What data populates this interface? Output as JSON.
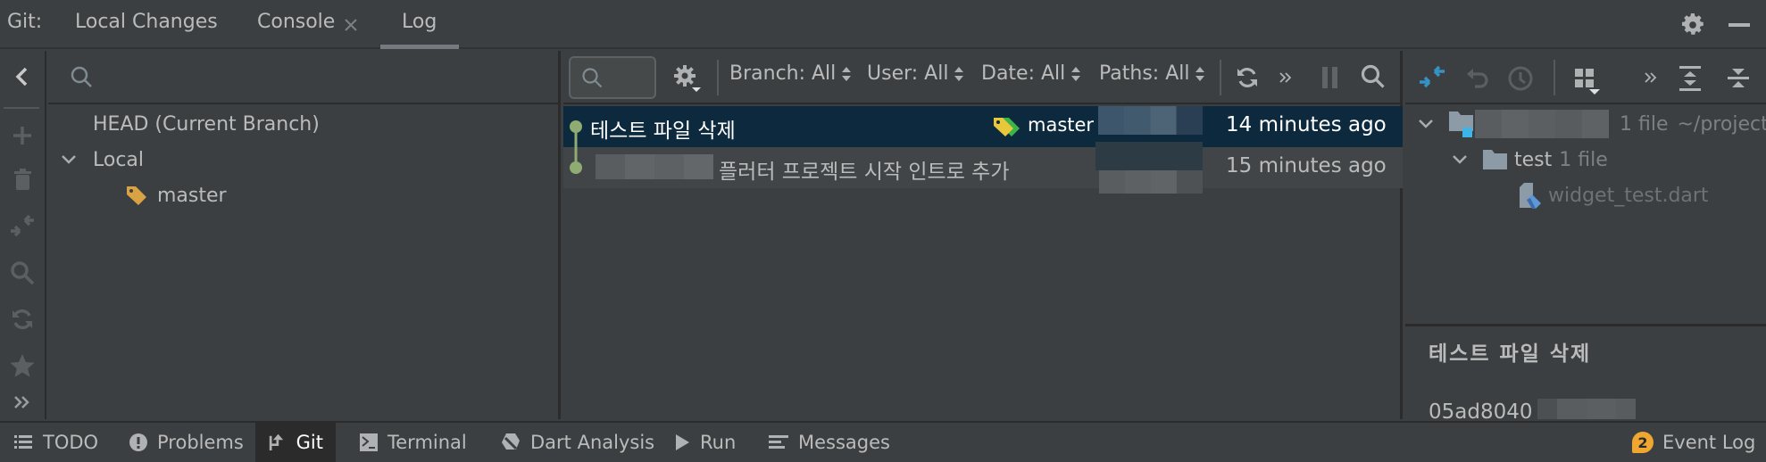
{
  "top_tabs": {
    "prefix": "Git:",
    "tabs": [
      {
        "label": "Local Changes",
        "active": false,
        "closable": false
      },
      {
        "label": "Console",
        "active": false,
        "closable": true
      },
      {
        "label": "Log",
        "active": true,
        "closable": false
      }
    ],
    "right_icons": [
      "gear-icon",
      "minimize-icon"
    ]
  },
  "left_toolbar": {
    "icons": [
      "collapse-left-icon",
      "add-icon",
      "delete-icon",
      "compare-icon",
      "search-icon",
      "update-icon",
      "favorite-icon",
      "more-icon"
    ]
  },
  "branches": {
    "search_placeholder": "",
    "tree": [
      {
        "label": "HEAD (Current Branch)",
        "level": 0,
        "expandable": false
      },
      {
        "label": "Local",
        "level": 0,
        "expandable": true,
        "expanded": true
      },
      {
        "label": "master",
        "level": 1,
        "icon": "tag-icon",
        "icon_color": "#d9a343"
      }
    ]
  },
  "log": {
    "search_value": "",
    "filters": [
      {
        "label": "Branch: All"
      },
      {
        "label": "User: All"
      },
      {
        "label": "Date: All"
      },
      {
        "label": "Paths: All"
      }
    ],
    "toolbar_icons": [
      "settings-icon",
      "refresh-icon",
      "more-icon",
      "pause-icon",
      "search-icon"
    ],
    "commits": [
      {
        "message": "테스트 파일 삭제",
        "branch_label": "master",
        "author": "[redacted]",
        "time": "14 minutes ago",
        "selected": true
      },
      {
        "message": "플러터 프로젝트 시작 인트로 추가",
        "message_prefix_redacted": true,
        "author": "[redacted]",
        "time": "15 minutes ago",
        "selected": false
      }
    ],
    "graph_color": "#8fac72"
  },
  "changes": {
    "toolbar_icons": [
      "diff-icon",
      "revert-icon",
      "history-icon",
      "group-by-icon",
      "more-icon",
      "expand-all-icon",
      "collapse-all-icon"
    ],
    "tree": [
      {
        "label": "[redacted]",
        "count": "1 file",
        "path": "~/project/",
        "level": 0,
        "icon": "module-folder-icon"
      },
      {
        "label": "test",
        "count": "1 file",
        "level": 1,
        "icon": "folder-icon"
      },
      {
        "label": "widget_test.dart",
        "level": 2,
        "icon": "dart-file-icon",
        "deleted": true
      }
    ],
    "details": {
      "subject": "테스트 파일 삭제",
      "hash": "05ad8040",
      "hash_suffix_redacted": true
    }
  },
  "bottom_bar": {
    "items": [
      {
        "label": "TODO",
        "icon": "list-icon"
      },
      {
        "label": "Problems",
        "icon": "warning-icon"
      },
      {
        "label": "Git",
        "icon": "git-branch-icon",
        "active": true
      },
      {
        "label": "Terminal",
        "icon": "terminal-icon"
      },
      {
        "label": "Dart Analysis",
        "icon": "dart-icon"
      },
      {
        "label": "Run",
        "icon": "play-icon"
      },
      {
        "label": "Messages",
        "icon": "messages-icon"
      }
    ],
    "event_log": {
      "label": "Event Log",
      "badge": "2",
      "badge_color": "#f0a732"
    }
  },
  "colors": {
    "background": "#3c3f41",
    "selected_row": "#0d293e",
    "second_row": "#414547",
    "accent_blue": "#3592c4"
  }
}
